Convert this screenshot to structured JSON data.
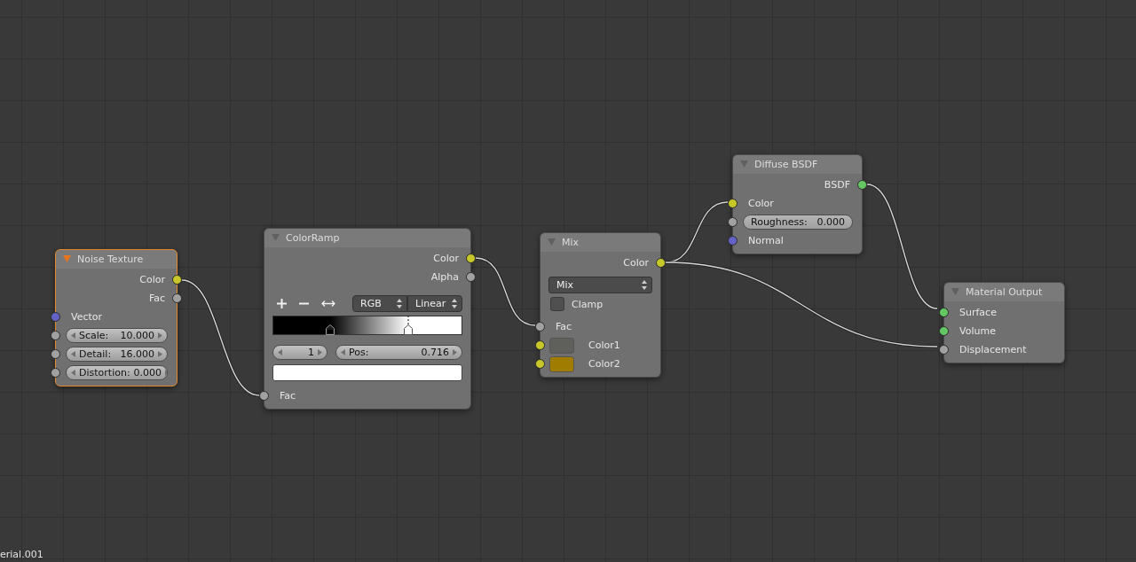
{
  "nodes": [
    {
      "title": "Noise Texture",
      "selected": true,
      "rows": [
        {
          "kind": "output",
          "label": "Color",
          "color": "#c7c729"
        },
        {
          "kind": "output",
          "label": "Fac",
          "color": "#a1a1a1"
        },
        {
          "kind": "input",
          "label": "Vector",
          "color": "#6363c7"
        },
        {
          "kind": "number",
          "label": "Scale:",
          "value": "10.000",
          "color": "#a1a1a1"
        },
        {
          "kind": "number",
          "label": "Detail:",
          "value": "16.000",
          "color": "#a1a1a1"
        },
        {
          "kind": "number",
          "label": "Distortion:",
          "value": "0.000",
          "color": "#a1a1a1"
        }
      ]
    },
    {
      "title": "ColorRamp",
      "selected": false,
      "rows": [
        {
          "kind": "output",
          "label": "Color",
          "color": "#c7c729"
        },
        {
          "kind": "output",
          "label": "Alpha",
          "color": "#a1a1a1"
        },
        {
          "kind": "ramp_tools",
          "color_mode": "RGB",
          "interpolation": "Linear"
        },
        {
          "kind": "ramp",
          "stops": [
            {
              "level": 0.3,
              "color": "#000000",
              "selected": false
            },
            {
              "level": 0.716,
              "color": "#ffffff",
              "selected": true
            }
          ]
        },
        {
          "kind": "stop_fields",
          "index": "1",
          "label": "Pos:",
          "value": "0.716"
        },
        {
          "kind": "swatch",
          "color": "#ffffff"
        },
        {
          "kind": "input",
          "label": "Fac",
          "color": "#a1a1a1"
        }
      ]
    },
    {
      "title": "Mix",
      "selected": false,
      "rows": [
        {
          "kind": "output",
          "label": "Color",
          "color": "#c7c729"
        },
        {
          "kind": "dropdown",
          "value": "Mix"
        },
        {
          "kind": "checkbox",
          "label": "Clamp",
          "checked": false
        },
        {
          "kind": "input",
          "label": "Fac",
          "color": "#a1a1a1"
        },
        {
          "kind": "color",
          "label": "Color1",
          "color": "#c7c729",
          "swatch": {
            "color": "#5f605b"
          }
        },
        {
          "kind": "color",
          "label": "Color2",
          "color": "#c7c729",
          "swatch": {
            "color": "#a07c00"
          }
        }
      ]
    },
    {
      "title": "Diffuse BSDF",
      "selected": false,
      "rows": [
        {
          "kind": "output",
          "label": "BSDF",
          "color": "#63c763"
        },
        {
          "kind": "input",
          "label": "Color",
          "color": "#c7c729"
        },
        {
          "kind": "slider",
          "label": "Roughness:",
          "value": "0.000",
          "color": "#a1a1a1"
        },
        {
          "kind": "input",
          "label": "Normal",
          "color": "#6363c7"
        }
      ]
    },
    {
      "title": "Material Output",
      "selected": false,
      "rows": [
        {
          "kind": "input",
          "label": "Surface",
          "color": "#63c763"
        },
        {
          "kind": "input",
          "label": "Volume",
          "color": "#63c763"
        },
        {
          "kind": "input",
          "label": "Displacement",
          "color": "#a1a1a1"
        }
      ]
    }
  ],
  "footer": "erial.001"
}
